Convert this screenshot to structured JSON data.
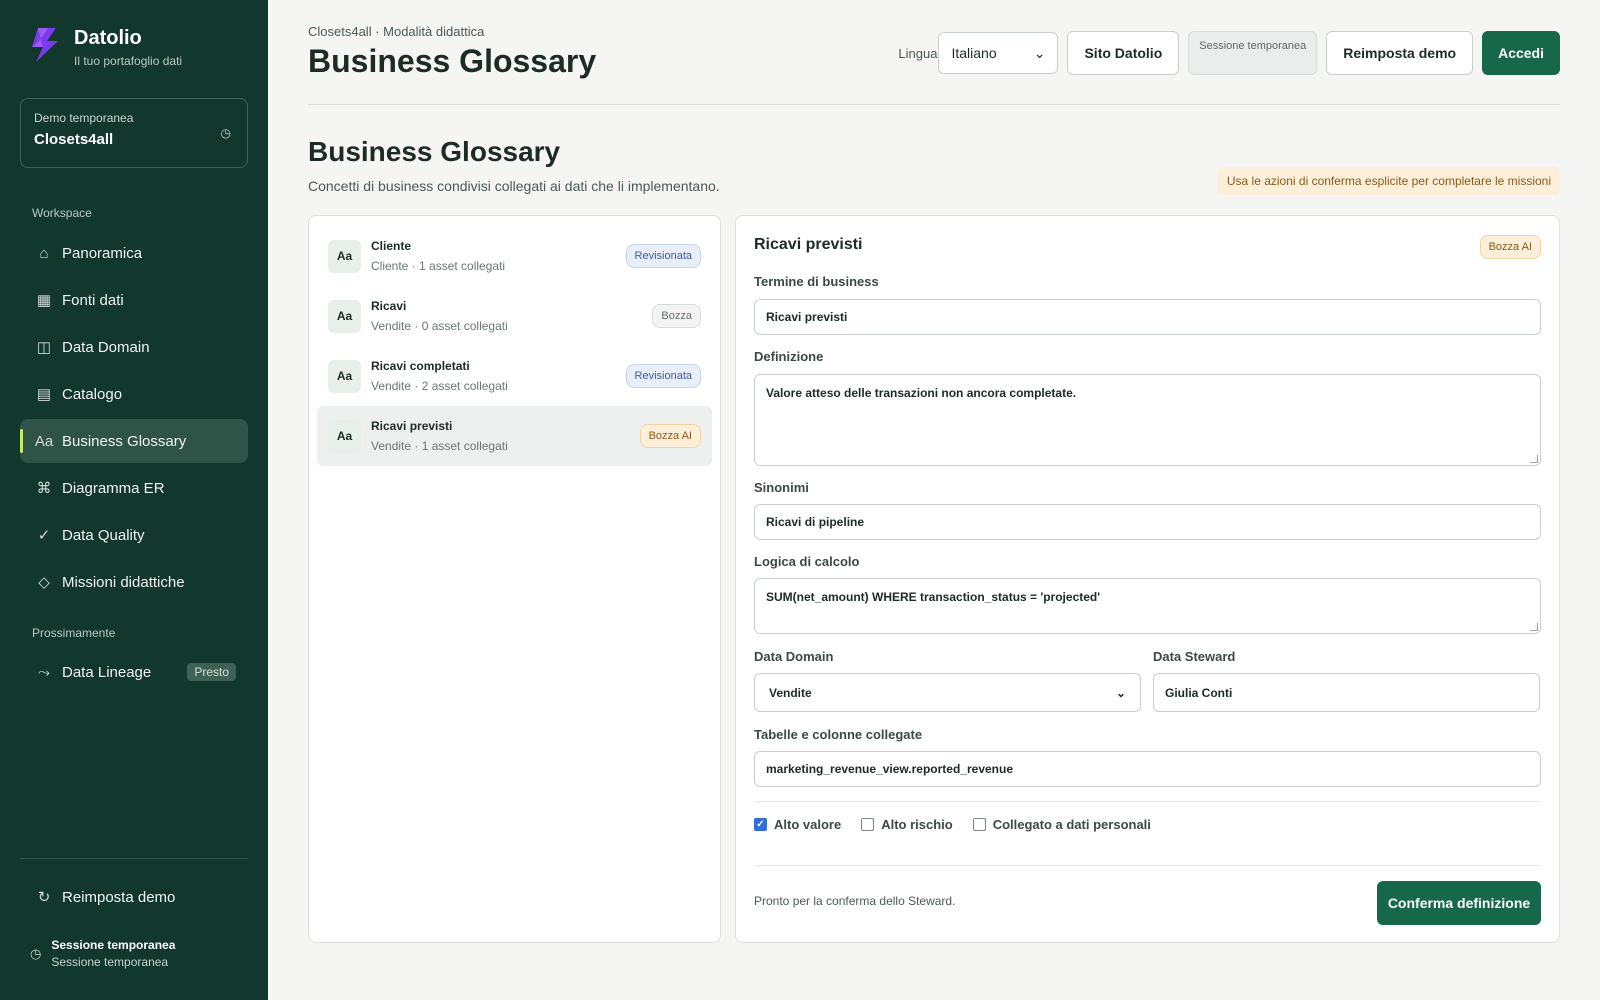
{
  "sidebar": {
    "brand": {
      "title": "Datolio",
      "subtitle": "Il tuo portafoglio dati",
      "logo_color": "#7c3aed"
    },
    "demo": {
      "label": "Demo temporanea",
      "value": "Closets4all",
      "icon": "clock-icon"
    },
    "workspace_label": "Workspace",
    "items": [
      {
        "label": "Panoramica",
        "icon": "home-icon",
        "glyph": "⌂"
      },
      {
        "label": "Fonti dati",
        "icon": "grid-icon",
        "glyph": "▦"
      },
      {
        "label": "Data Domain",
        "icon": "columns-icon",
        "glyph": "◫"
      },
      {
        "label": "Catalogo",
        "icon": "list-icon",
        "glyph": "▤"
      },
      {
        "label": "Business Glossary",
        "icon": "glossary-icon",
        "glyph": "Aa",
        "active": true
      },
      {
        "label": "Diagramma ER",
        "icon": "er-icon",
        "glyph": "⌘"
      },
      {
        "label": "Data Quality",
        "icon": "check-icon",
        "glyph": "✓"
      },
      {
        "label": "Missioni didattiche",
        "icon": "diamond-icon",
        "glyph": "◇"
      }
    ],
    "upcoming_label": "Prossimamente",
    "upcoming": [
      {
        "label": "Data Lineage",
        "icon": "lineage-icon",
        "glyph": "⤳",
        "badge": "Presto"
      }
    ],
    "reset": {
      "label": "Reimposta demo",
      "icon": "refresh-icon",
      "glyph": "↻"
    },
    "session": {
      "title": "Sessione temporanea",
      "subtitle": "Sessione temporanea",
      "icon": "clock-icon"
    }
  },
  "header": {
    "breadcrumb": "Closets4all · Modalità didattica",
    "title": "Business Glossary",
    "language_label": "Lingua",
    "language_value": "Italiano",
    "site_button": "Sito Datolio",
    "session_chip": "Sessione temporanea",
    "reset_button": "Reimposta demo",
    "login_button": "Accedi"
  },
  "section": {
    "title": "Business Glossary",
    "description": "Concetti di business condivisi collegati ai dati che li implementano.",
    "hint": "Usa le azioni di conferma esplicite per completare le missioni"
  },
  "terms": [
    {
      "avatar": "Aa",
      "name": "Cliente",
      "meta": "Cliente · 1 asset collegati",
      "status": "Revisionata",
      "status_type": "rev"
    },
    {
      "avatar": "Aa",
      "name": "Ricavi",
      "meta": "Vendite · 0 asset collegati",
      "status": "Bozza",
      "status_type": "draft"
    },
    {
      "avatar": "Aa",
      "name": "Ricavi completati",
      "meta": "Vendite · 2 asset collegati",
      "status": "Revisionata",
      "status_type": "rev"
    },
    {
      "avatar": "Aa",
      "name": "Ricavi previsti",
      "meta": "Vendite · 1 asset collegati",
      "status": "Bozza AI",
      "status_type": "ai",
      "selected": true
    }
  ],
  "detail": {
    "title": "Ricavi previsti",
    "badge": "Bozza AI",
    "term_label": "Termine di business",
    "term_value": "Ricavi previsti",
    "definition_label": "Definizione",
    "definition_value": "Valore atteso delle transazioni non ancora completate.",
    "synonyms_label": "Sinonimi",
    "synonyms_value": "Ricavi di pipeline",
    "logic_label": "Logica di calcolo",
    "logic_value": "SUM(net_amount) WHERE transaction_status = 'projected'",
    "domain_label": "Data Domain",
    "domain_value": "Vendite",
    "steward_label": "Data Steward",
    "steward_value": "Giulia Conti",
    "linked_label": "Tabelle e colonne collegate",
    "linked_value": "marketing_revenue_view.reported_revenue",
    "flags": [
      {
        "label": "Alto valore",
        "checked": true
      },
      {
        "label": "Alto rischio",
        "checked": false
      },
      {
        "label": "Collegato a dati personali",
        "checked": false
      }
    ],
    "footer_note": "Pronto per la conferma dello Steward.",
    "confirm_button": "Conferma definizione"
  },
  "colors": {
    "sidebar_bg": "#12372c",
    "primary": "#17684a",
    "accent": "#c7e86b",
    "ai_badge": "#fcefd9",
    "review_badge": "#e8eef8"
  }
}
